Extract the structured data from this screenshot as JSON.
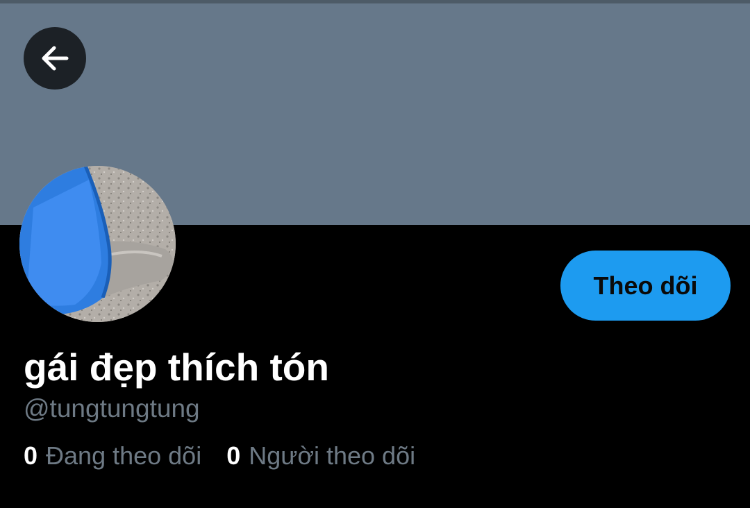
{
  "colors": {
    "banner": "#66788a",
    "background": "#000000",
    "accent": "#1d9bf0",
    "secondary_text": "#6e7a85"
  },
  "header": {
    "back_icon": "arrow-left-icon"
  },
  "profile": {
    "avatar_description_icon": "avatar-photo",
    "follow_label": "Theo dõi",
    "display_name": "gái đẹp thích tón",
    "handle": "@tungtungtung",
    "stats": {
      "following": {
        "count": "0",
        "label": "Đang theo dõi"
      },
      "followers": {
        "count": "0",
        "label": "Người theo dõi"
      }
    }
  }
}
